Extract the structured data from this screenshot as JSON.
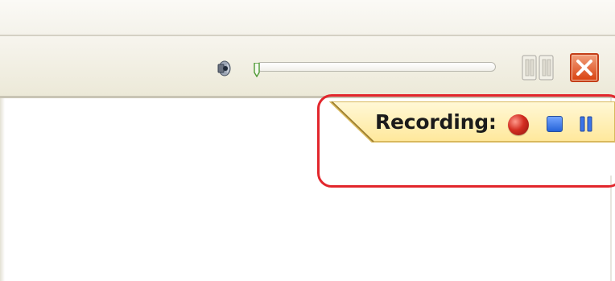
{
  "window": {
    "toolbar": {
      "volume_icon": "speaker-icon",
      "volume_level": 0.0,
      "layout_icon": "column-layout-icon",
      "close_icon": "close-x-icon"
    }
  },
  "recording_panel": {
    "label": "Recording:",
    "record_icon": "record-dot-icon",
    "stop_icon": "stop-square-icon",
    "pause_icon": "pause-bars-icon"
  },
  "annotation": {
    "color": "#e2262c"
  },
  "colors": {
    "panel_yellow": "#fff0b8",
    "panel_border": "#d9b95d",
    "close_red": "#d8410f",
    "record_red": "#d32d21",
    "stop_blue": "#2563d8"
  }
}
